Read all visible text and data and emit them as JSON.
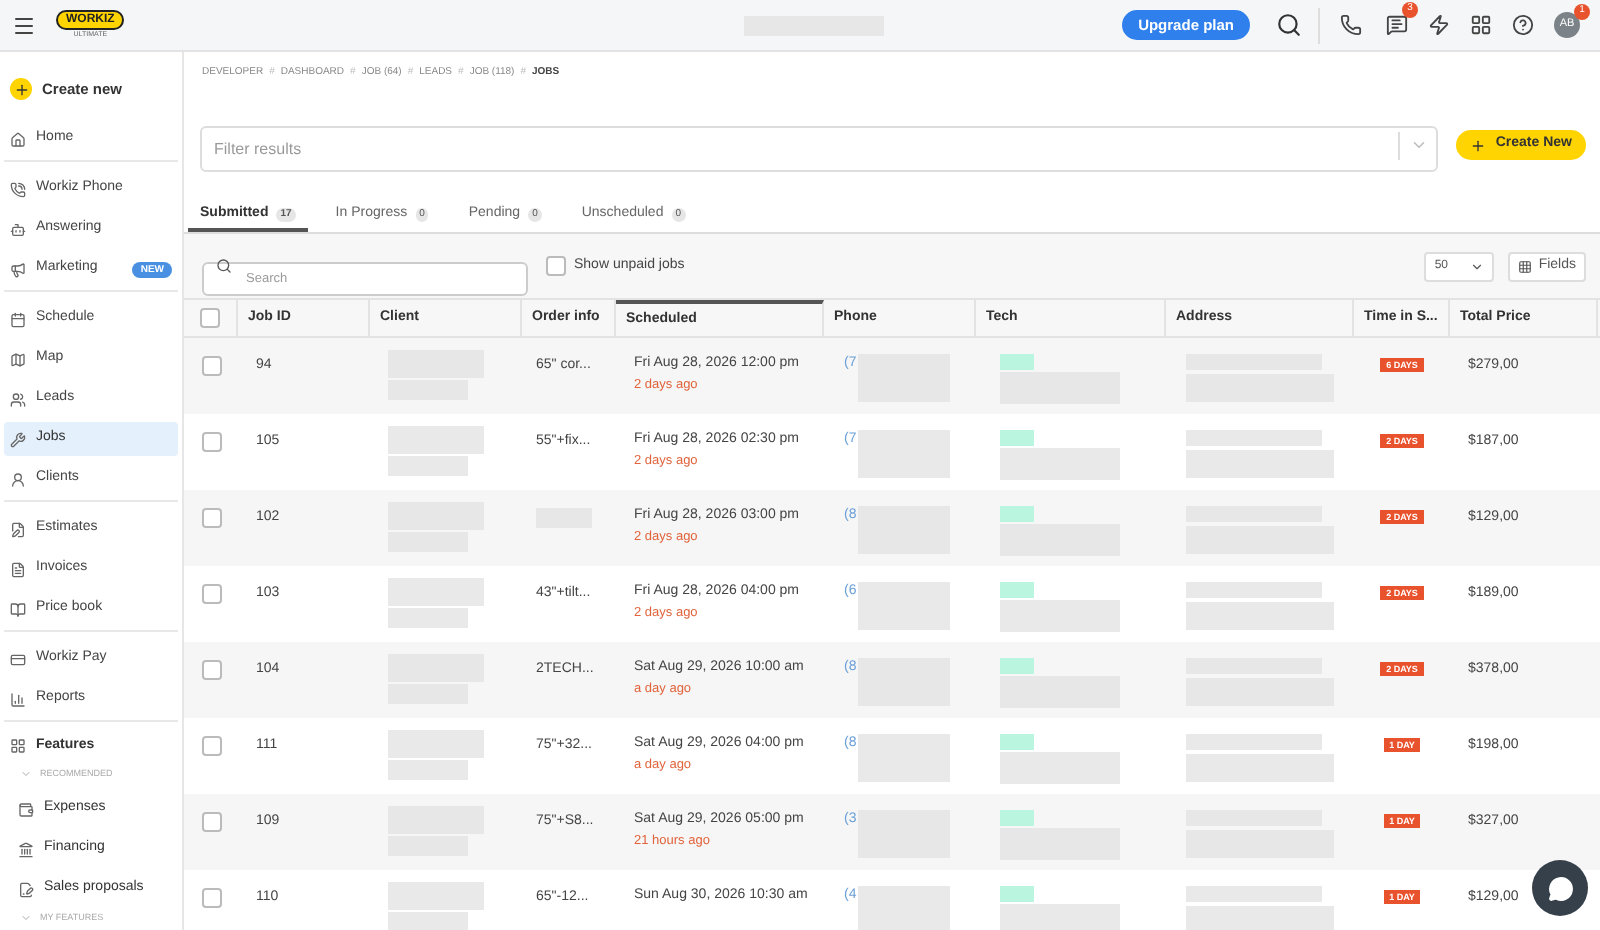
{
  "topbar": {
    "logo": "WORKIZ",
    "plan_label": "ULTIMATE",
    "upgrade_button": "Upgrade plan",
    "messages_badge": "3",
    "avatar": "AB",
    "avatar_badge": "1"
  },
  "sidebar": {
    "create_button": "Create new",
    "sections": [
      {
        "items": [
          {
            "label": "Home",
            "selected": false
          }
        ]
      },
      {
        "items": [
          {
            "label": "Workiz Phone",
            "selected": false
          },
          {
            "label": "Answering",
            "selected": false
          },
          {
            "label": "Marketing",
            "selected": false,
            "badge": "NEW"
          }
        ]
      },
      {
        "items": [
          {
            "label": "Schedule",
            "selected": false
          },
          {
            "label": "Map",
            "selected": false
          },
          {
            "label": "Leads",
            "selected": false
          },
          {
            "label": "Jobs",
            "selected": true
          },
          {
            "label": "Clients",
            "selected": false
          }
        ]
      },
      {
        "items": [
          {
            "label": "Estimates",
            "selected": false
          },
          {
            "label": "Invoices",
            "selected": false
          },
          {
            "label": "Price book",
            "selected": false
          }
        ]
      },
      {
        "items": [
          {
            "label": "Workiz Pay",
            "selected": false
          },
          {
            "label": "Reports",
            "selected": false
          }
        ]
      }
    ],
    "features": {
      "label": "Features",
      "groups": [
        {
          "label": "RECOMMENDED",
          "expanded": true,
          "items": [
            {
              "label": "Expenses",
              "selected": false
            },
            {
              "label": "Financing",
              "selected": false
            },
            {
              "label": "Sales proposals",
              "selected": false
            }
          ]
        },
        {
          "label": "MY FEATURES",
          "expanded": true
        }
      ]
    }
  },
  "breadcrumb": {
    "separator": "#",
    "items": [
      "DEVELOPER",
      "DASHBOARD",
      "JOB (64)",
      "LEADS",
      "JOB (118)",
      "JOBS"
    ]
  },
  "filter": {
    "placeholder": "Filter results"
  },
  "create_new_button": "Create New",
  "tabs": [
    {
      "label": "Submitted",
      "count": "17",
      "selected": true
    },
    {
      "label": "In Progress",
      "count": "0",
      "selected": false
    },
    {
      "label": "Pending",
      "count": "0",
      "selected": false
    },
    {
      "label": "Unscheduled",
      "count": "0",
      "selected": false
    }
  ],
  "search": {
    "placeholder": "Search"
  },
  "show_unpaid": {
    "label": "Show unpaid jobs",
    "checked": false
  },
  "page_size": "50",
  "fields_button": "Fields",
  "table": {
    "all_checked": false,
    "columns": [
      "Job ID",
      "Client",
      "Order info",
      "Scheduled",
      "Phone",
      "Tech",
      "Address",
      "Time in S...",
      "Total Price"
    ],
    "rows": [
      {
        "checked": false,
        "job_id": "94",
        "order_info": "65\" cor...",
        "scheduled": "Fri Aug 28, 2026 12:00 pm",
        "ago": "2 days ago",
        "phone": "(7",
        "time_in_status": "6 DAYS",
        "price": "$279,00"
      },
      {
        "checked": false,
        "job_id": "105",
        "order_info": "55\"+fix...",
        "scheduled": "Fri Aug 28, 2026 02:30 pm",
        "ago": "2 days ago",
        "phone": "(7",
        "time_in_status": "2 DAYS",
        "price": "$187,00"
      },
      {
        "checked": false,
        "job_id": "102",
        "scheduled": "Fri Aug 28, 2026 03:00 pm",
        "ago": "2 days ago",
        "phone": "(8",
        "time_in_status": "2 DAYS",
        "price": "$129,00"
      },
      {
        "checked": false,
        "job_id": "103",
        "order_info": "43\"+tilt...",
        "scheduled": "Fri Aug 28, 2026 04:00 pm",
        "ago": "2 days ago",
        "phone": "(6",
        "time_in_status": "2 DAYS",
        "price": "$189,00"
      },
      {
        "checked": false,
        "job_id": "104",
        "order_info": "2TECH...",
        "scheduled": "Sat Aug 29, 2026 10:00 am",
        "ago": "a day ago",
        "phone": "(8",
        "time_in_status": "2 DAYS",
        "price": "$378,00"
      },
      {
        "checked": false,
        "job_id": "111",
        "order_info": "75\"+32...",
        "scheduled": "Sat Aug 29, 2026 04:00 pm",
        "ago": "a day ago",
        "phone": "(8",
        "time_in_status": "1 DAY",
        "price": "$198,00"
      },
      {
        "checked": false,
        "job_id": "109",
        "order_info": "75\"+S8...",
        "scheduled": "Sat Aug 29, 2026 05:00 pm",
        "ago": "21 hours ago",
        "phone": "(3",
        "time_in_status": "1 DAY",
        "price": "$327,00"
      },
      {
        "checked": false,
        "job_id": "110",
        "order_info": "65\"-12...",
        "scheduled": "Sun Aug 30, 2026 10:30 am",
        "phone": "(4",
        "time_in_status": "1 DAY",
        "price": "$129,00"
      }
    ]
  }
}
